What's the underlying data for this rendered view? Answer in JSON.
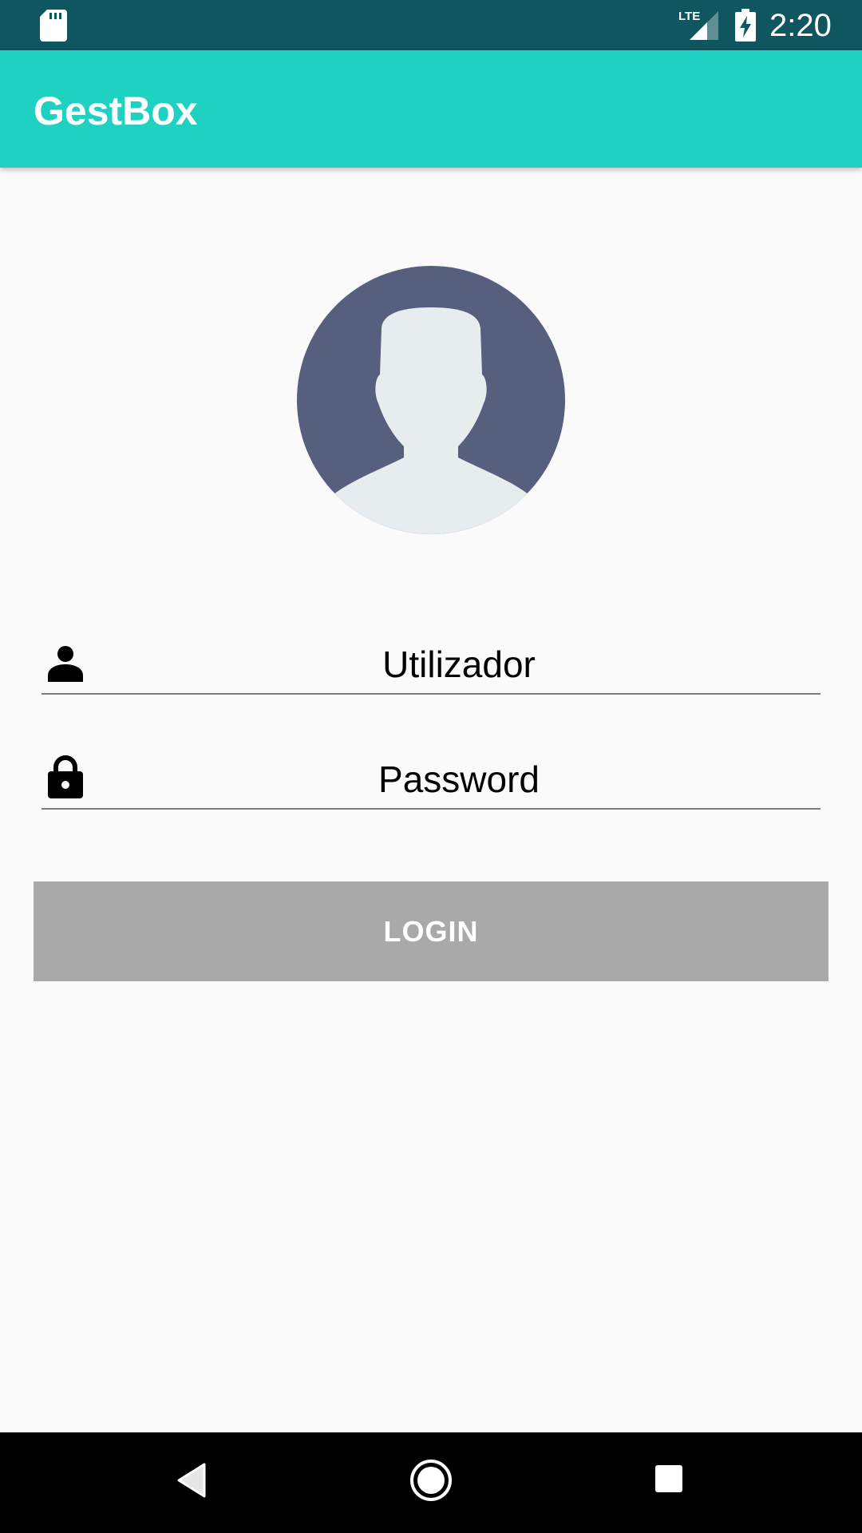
{
  "status_bar": {
    "time": "2:20",
    "network_label": "LTE",
    "icons": [
      "sd-card-icon",
      "lte-signal-icon",
      "battery-charging-icon"
    ]
  },
  "app_bar": {
    "title": "GestBox",
    "color": "#1fd1c1"
  },
  "login_form": {
    "avatar_icon": "default-user-avatar",
    "username": {
      "icon": "person-icon",
      "placeholder": "Utilizador",
      "value": ""
    },
    "password": {
      "icon": "lock-icon",
      "placeholder": "Password",
      "value": ""
    },
    "login_button": {
      "label": "LOGIN",
      "color": "#a9a9a9"
    }
  },
  "nav_bar": {
    "icons": [
      "back-icon",
      "home-icon",
      "recents-icon"
    ]
  },
  "colors": {
    "status_bar": "#0f5661",
    "background": "#fafafa",
    "avatar_bg": "#565f7e",
    "avatar_figure": "#e7ecee"
  }
}
